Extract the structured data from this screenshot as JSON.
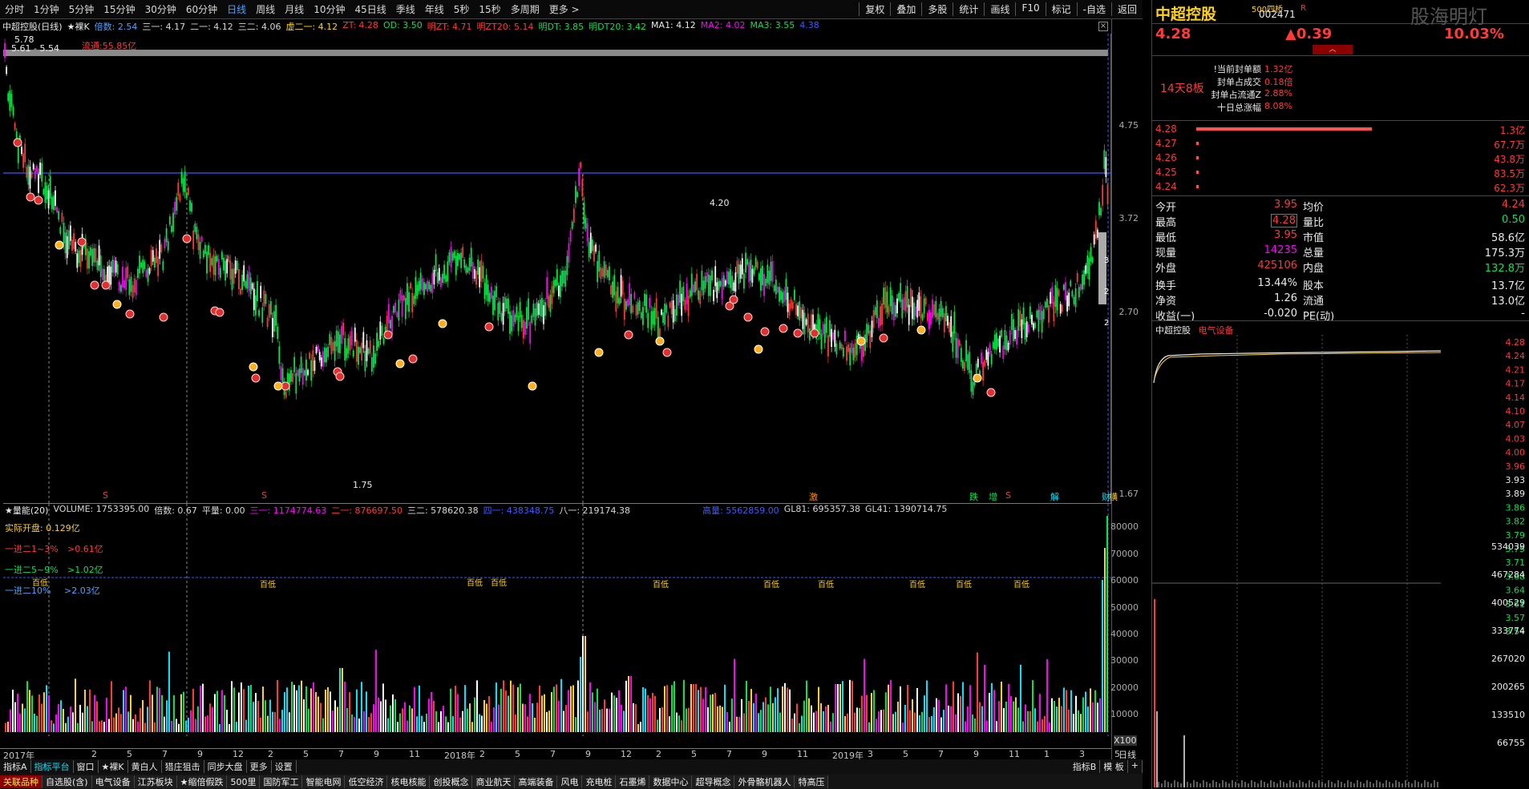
{
  "toolbar": {
    "periods": [
      "分时",
      "1分钟",
      "5分钟",
      "15分钟",
      "30分钟",
      "60分钟",
      "日线",
      "周线",
      "月线",
      "10分钟",
      "45日线",
      "季线",
      "年线",
      "5秒",
      "15秒",
      "多周期",
      "更多 >"
    ],
    "active_index": 6,
    "right_buttons": [
      "复权",
      "叠加",
      "多股",
      "统计",
      "画线",
      "F10",
      "标记",
      "-自选",
      "返回"
    ]
  },
  "info": {
    "title": "中超控股(日线)",
    "k_label": "★裸K",
    "items": [
      {
        "t": "倍数: 2.54",
        "c": "#4aa3ff"
      },
      {
        "t": "三一: 4.17",
        "c": "#d8d8d8"
      },
      {
        "t": "二一: 4.12",
        "c": "#d8d8d8"
      },
      {
        "t": "三二: 4.06",
        "c": "#d8d8d8"
      },
      {
        "t": "虚二一: 4.12",
        "c": "#ffd21e"
      },
      {
        "t": "ZT: 4.28",
        "c": "#ff3838"
      },
      {
        "t": "OD: 3.50",
        "c": "#00e64d"
      },
      {
        "t": "明ZT: 4.71",
        "c": "#ff3838"
      },
      {
        "t": "明ZT20: 5.14",
        "c": "#ff3838"
      },
      {
        "t": "明DT: 3.85",
        "c": "#00e64d"
      },
      {
        "t": "明DT20: 3.42",
        "c": "#00e64d"
      },
      {
        "t": "MA1: 4.12",
        "c": "#eaeaea"
      },
      {
        "t": "MA2: 4.02",
        "c": "#ff00ff"
      },
      {
        "t": "MA3: 3.55",
        "c": "#00e64d"
      },
      {
        "t": "4.38",
        "c": "#3c5aff"
      }
    ]
  },
  "main": {
    "hi_label": "5.78",
    "range_label": "5.61 - 5.54",
    "float_label": "流通:55.85亿",
    "peak_label": "4.20",
    "low_label": "1.75",
    "axis": [
      "4.75",
      "3.72",
      "2.70",
      "1.67"
    ],
    "gray_marks": [
      "3",
      "2",
      "2"
    ],
    "tags": [
      {
        "t": "S",
        "c": "#ff3838"
      },
      {
        "t": "S",
        "c": "#ff3838"
      },
      {
        "t": "激",
        "c": "#ff8c00"
      },
      {
        "t": "跌",
        "c": "#00e64d"
      },
      {
        "t": "增",
        "c": "#00e64d"
      },
      {
        "t": "S",
        "c": "#ff3838"
      },
      {
        "t": "解",
        "c": "#00e5ff"
      },
      {
        "t": "财",
        "c": "#00e5ff"
      },
      {
        "t": "横",
        "c": "#ffd21e"
      }
    ]
  },
  "volume": {
    "title": "★量能(20)",
    "items": [
      {
        "t": "VOLUME: 1753395.00",
        "c": "#d8d8d8"
      },
      {
        "t": "倍数: 0.67",
        "c": "#d8d8d8"
      },
      {
        "t": "平量: 0.00",
        "c": "#d8d8d8"
      },
      {
        "t": "三一: 1174774.63",
        "c": "#ff00ff"
      },
      {
        "t": "二一: 876697.50",
        "c": "#ff3838"
      },
      {
        "t": "三二: 578620.38",
        "c": "#d8d8d8"
      },
      {
        "t": "四一: 438348.75",
        "c": "#3c5aff"
      },
      {
        "t": "八一: 219174.38",
        "c": "#d8d8d8"
      }
    ],
    "items2": [
      {
        "t": "高量: 5562859.00",
        "c": "#3c5aff"
      },
      {
        "t": "GL81: 695357.38",
        "c": "#d8d8d8"
      },
      {
        "t": "GL41: 1390714.75",
        "c": "#d8d8d8"
      }
    ],
    "l1": "实际开盘: 0.129亿",
    "l2a": "一进二1~3%",
    "l2b": ">0.61亿",
    "l3a": "一进二5~9%",
    "l3b": ">1.02亿",
    "l4a": "一进二10%",
    "l4b": ">2.03亿",
    "axis": [
      "80000",
      "70000",
      "60000",
      "50000",
      "40000",
      "30000",
      "20000",
      "10000"
    ],
    "x100": "X100",
    "low_marks": [
      "百低",
      "百低",
      "百低",
      "百低",
      "百低",
      "百低",
      "百低",
      "百低",
      "百低",
      "百低"
    ]
  },
  "dates": {
    "labels": [
      "2017年",
      "2",
      "5",
      "7",
      "9",
      "12",
      "2",
      "5",
      "7",
      "9",
      "11",
      "2018年",
      "2",
      "5",
      "7",
      "9",
      "12",
      "2",
      "5",
      "7",
      "9",
      "11",
      "2019年",
      "3",
      "5",
      "7",
      "9",
      "11",
      "1",
      "3",
      "5"
    ]
  },
  "tabs1": {
    "items": [
      "指标A",
      "指标平台",
      "窗口",
      "★裸K",
      "黄白人",
      "猎庄狙击",
      "同步大盘",
      "更多",
      "设置"
    ],
    "right": [
      "指标B",
      "模 板",
      "+"
    ],
    "active_index": 1
  },
  "tabs2": {
    "items": [
      "关联品种",
      "自选股(含)",
      "电气设备",
      "江苏板块",
      "★缩倍假跌",
      "500里",
      "国防军工",
      "智能电网",
      "低空经济",
      "核电核能",
      "创投概念",
      "商业航天",
      "高端装备",
      "风电",
      "充电桩",
      "石墨烯",
      "数据中心",
      "超导概念",
      "外骨骼机器人",
      "特高压"
    ],
    "active_index": 0
  },
  "quote": {
    "name": "中超控股",
    "code": "002471",
    "badge": "500四桥",
    "r": "R",
    "price": "4.28",
    "change": "▲0.39",
    "pct": "10.03%",
    "watermark": "股海明灯",
    "ladder": "14天8板",
    "seal": [
      {
        "k": "!当前封单额",
        "v": "1.32亿"
      },
      {
        "k": "封单占成交",
        "v": "0.18倍"
      },
      {
        "k": "封单占流通Z",
        "v": "2.88%"
      },
      {
        "k": "十日总涨幅",
        "v": "8.08%"
      }
    ],
    "book": [
      {
        "p": "4.28",
        "v": "1.3亿",
        "w": 0.95
      },
      {
        "p": "4.27",
        "v": "67.7万",
        "w": 0.004
      },
      {
        "p": "4.26",
        "v": "43.8万",
        "w": 0.003
      },
      {
        "p": "4.25",
        "v": "83.5万",
        "w": 0.005
      },
      {
        "p": "4.24",
        "v": "62.3万",
        "w": 0.004
      }
    ],
    "stats": [
      [
        "今开",
        "3.95",
        "均价",
        "4.24"
      ],
      [
        "最高",
        "4.28",
        "量比",
        "0.50"
      ],
      [
        "最低",
        "3.95",
        "市值",
        "58.6亿"
      ],
      [
        "现量",
        "14235",
        "总量",
        "175.3万"
      ],
      [
        "外盘",
        "425106",
        "内盘",
        "132.8万"
      ],
      [
        "换手",
        "13.44%",
        "股本",
        "13.7亿"
      ],
      [
        "净资",
        "1.26",
        "流通",
        "13.0亿"
      ],
      [
        "收益(一)",
        "-0.020",
        "PE(动)",
        "-"
      ]
    ],
    "intra_name": "中超控股",
    "intra_sector": "电气设备",
    "intra_axis": [
      "4.28",
      "4.24",
      "4.21",
      "4.17",
      "4.14",
      "4.10",
      "4.07",
      "4.03",
      "4.00",
      "3.96",
      "3.93",
      "3.89",
      "3.86",
      "3.82",
      "3.79",
      "3.75",
      "3.71",
      "3.68",
      "3.64",
      "3.61",
      "3.57",
      "3.54"
    ],
    "intra_vol": [
      "534039",
      "467284",
      "400529",
      "333774",
      "267020",
      "200265",
      "133510",
      "66755"
    ],
    "intra_close": "日线"
  },
  "colors": {
    "up": "#ff3838",
    "down": "#00e64d",
    "blue": "#3c5aff",
    "yellow": "#ffd21e"
  }
}
